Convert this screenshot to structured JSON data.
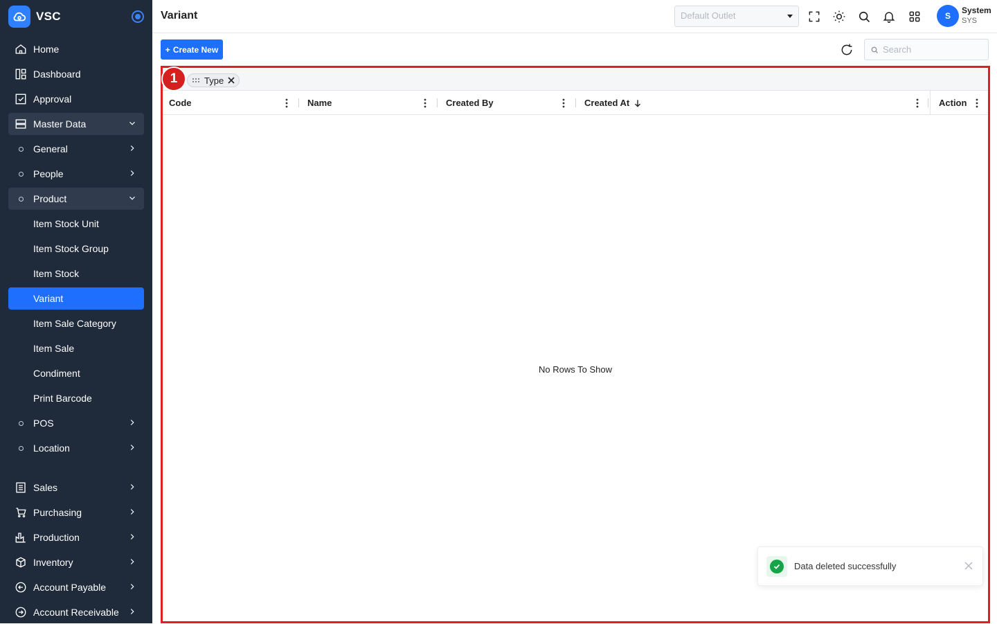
{
  "app": {
    "name": "VSC"
  },
  "sidebar": {
    "items": [
      {
        "label": "Home",
        "icon": "home-icon"
      },
      {
        "label": "Dashboard",
        "icon": "dashboard-icon"
      },
      {
        "label": "Approval",
        "icon": "approval-icon"
      },
      {
        "label": "Master Data",
        "icon": "master-data-icon",
        "expanded": true
      },
      {
        "label": "General",
        "icon": "circle-icon"
      },
      {
        "label": "People",
        "icon": "circle-icon"
      },
      {
        "label": "Product",
        "icon": "circle-icon",
        "expanded": true
      },
      {
        "label": "Item Stock Unit"
      },
      {
        "label": "Item Stock Group"
      },
      {
        "label": "Item Stock"
      },
      {
        "label": "Variant",
        "active": true
      },
      {
        "label": "Item Sale Category"
      },
      {
        "label": "Item Sale"
      },
      {
        "label": "Condiment"
      },
      {
        "label": "Print Barcode"
      },
      {
        "label": "POS",
        "icon": "circle-icon"
      },
      {
        "label": "Location",
        "icon": "circle-icon"
      },
      {
        "label": "Sales",
        "icon": "sales-icon"
      },
      {
        "label": "Purchasing",
        "icon": "cart-icon"
      },
      {
        "label": "Production",
        "icon": "factory-icon"
      },
      {
        "label": "Inventory",
        "icon": "box-icon"
      },
      {
        "label": "Account Payable",
        "icon": "arrow-circle-left-icon"
      },
      {
        "label": "Account Receivable",
        "icon": "arrow-circle-right-icon"
      }
    ]
  },
  "header": {
    "title": "Variant",
    "outlet_placeholder": "Default Outlet",
    "user": {
      "initial": "S",
      "name": "System",
      "code": "SYS"
    }
  },
  "toolbar": {
    "create_label": "Create New",
    "search_placeholder": "Search"
  },
  "grid": {
    "annotation_badge": "1",
    "group_chip": "Type",
    "columns": [
      "Code",
      "Name",
      "Created By",
      "Created At",
      "Action"
    ],
    "sort_column": "Created At",
    "sort_direction": "desc",
    "empty_text": "No Rows To Show",
    "highlight_color": "#e02020"
  },
  "toast": {
    "message": "Data deleted successfully",
    "status_color": "#16a34a"
  },
  "colors": {
    "sidebar_bg": "#1f2a3b",
    "accent": "#1f6fff"
  }
}
